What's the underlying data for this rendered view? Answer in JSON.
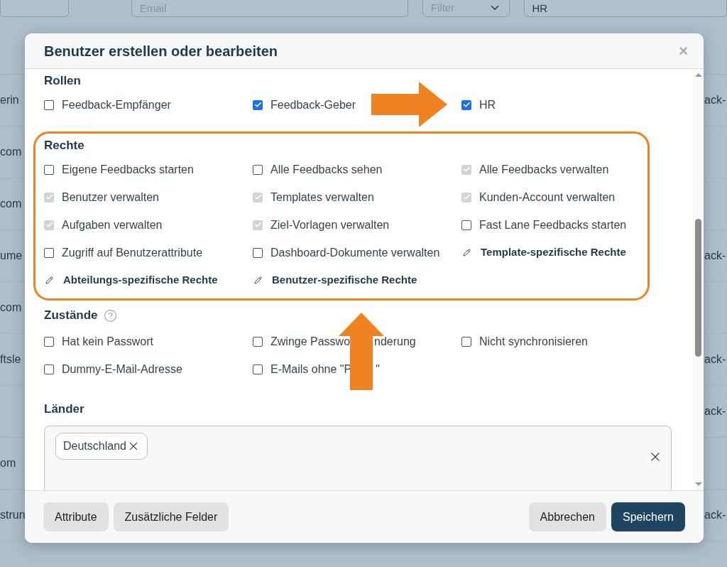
{
  "background": {
    "filters": [
      {
        "kind": "empty"
      },
      {
        "kind": "input",
        "placeholder": "Email"
      },
      {
        "kind": "select",
        "placeholder": "Filter"
      },
      {
        "kind": "input",
        "value": "HR"
      }
    ],
    "rows": [
      {
        "left": "erin",
        "right": "ack-"
      },
      {
        "left": "com"
      },
      {
        "left": "com"
      },
      {
        "left": "ume",
        "right": "ack-"
      },
      {
        "left": "com"
      },
      {
        "left": "ftsle",
        "right": "ack-"
      },
      {
        "right": "ack-"
      },
      {
        "left": "om"
      },
      {
        "left": "strun",
        "right": "ack-"
      }
    ]
  },
  "dialog": {
    "title": "Benutzer erstellen oder bearbeiten",
    "close": "×",
    "sections": [
      {
        "title": "Rollen",
        "items": [
          {
            "kind": "checkbox",
            "label": "Feedback-Empfänger",
            "checked": false,
            "disabled": false
          },
          {
            "kind": "checkbox",
            "label": "Feedback-Geber",
            "checked": true,
            "disabled": false
          },
          {
            "kind": "checkbox",
            "label": "HR",
            "checked": true,
            "disabled": false
          }
        ]
      },
      {
        "title": "Rechte",
        "highlighted": true,
        "items": [
          {
            "kind": "checkbox",
            "label": "Eigene Feedbacks starten",
            "checked": false,
            "disabled": false
          },
          {
            "kind": "checkbox",
            "label": "Alle Feedbacks sehen",
            "checked": false,
            "disabled": false
          },
          {
            "kind": "checkbox",
            "label": "Alle Feedbacks verwalten",
            "checked": true,
            "disabled": true
          },
          {
            "kind": "checkbox",
            "label": "Benutzer verwalten",
            "checked": true,
            "disabled": true
          },
          {
            "kind": "checkbox",
            "label": "Templates verwalten",
            "checked": true,
            "disabled": true
          },
          {
            "kind": "checkbox",
            "label": "Kunden-Account verwalten",
            "checked": true,
            "disabled": true
          },
          {
            "kind": "checkbox",
            "label": "Aufgaben verwalten",
            "checked": true,
            "disabled": true
          },
          {
            "kind": "checkbox",
            "label": "Ziel-Vorlagen verwalten",
            "checked": true,
            "disabled": true
          },
          {
            "kind": "checkbox",
            "label": "Fast Lane Feedbacks starten",
            "checked": false,
            "disabled": false
          },
          {
            "kind": "checkbox",
            "label": "Zugriff auf Benutzerattribute",
            "checked": false,
            "disabled": false
          },
          {
            "kind": "checkbox",
            "label": "Dashboard-Dokumente verwalten",
            "checked": false,
            "disabled": false
          },
          {
            "kind": "link",
            "label": "Template-spezifische Rechte"
          },
          {
            "kind": "link",
            "label": "Abteilungs-spezifische Rechte"
          },
          {
            "kind": "link",
            "label": "Benutzer-spezifische Rechte"
          }
        ]
      },
      {
        "title": "Zustände",
        "help": true,
        "items": [
          {
            "kind": "checkbox",
            "label": "Hat kein Passwort",
            "checked": false,
            "disabled": false
          },
          {
            "kind": "checkbox",
            "label_parts": [
              "Zwinge Passwo",
              "nderung"
            ],
            "checked": false,
            "disabled": false
          },
          {
            "kind": "checkbox",
            "label": "Nicht synchronisieren",
            "checked": false,
            "disabled": false
          },
          {
            "kind": "checkbox",
            "label": "Dummy-E-Mail-Adresse",
            "checked": false,
            "disabled": false
          },
          {
            "kind": "checkbox",
            "label_parts": [
              "E-Mails ohne \"P",
              "\""
            ],
            "checked": false,
            "disabled": false
          }
        ]
      }
    ],
    "countries": {
      "label": "Länder",
      "tags": [
        "Deutschland"
      ]
    },
    "footer_left": [
      "Attribute",
      "Zusätzliche Felder"
    ],
    "footer_right": [
      {
        "label": "Abbrechen",
        "kind": "secondary"
      },
      {
        "label": "Speichern",
        "kind": "primary"
      }
    ]
  }
}
